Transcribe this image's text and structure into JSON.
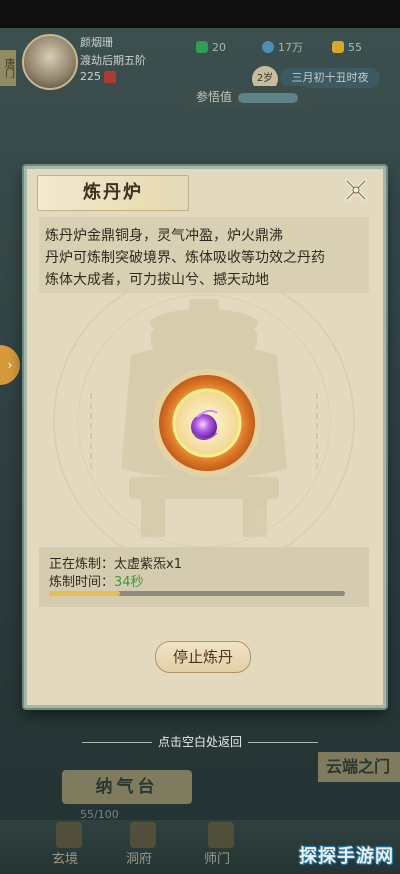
{
  "status_bar": {},
  "player": {
    "side_tag": "唐门",
    "name": "颜烟珊",
    "realm": "渡劫后期五阶",
    "power": "225"
  },
  "resources": [
    {
      "value": "20",
      "color": "#2f9e5a"
    },
    {
      "value": "17万",
      "color": "#4f8fb3"
    },
    {
      "value": "55",
      "color": "#d9a62e"
    }
  ],
  "world": {
    "age_badge": "2岁",
    "date": "三月初十丑时夜",
    "insight_label": "参悟值"
  },
  "modal": {
    "title": "炼丹炉",
    "description": [
      "炼丹炉金鼎铜身，灵气冲盈，炉火鼎沸",
      "丹炉可炼制突破境界、炼体吸收等功效之丹药",
      "炼体大成者，可力拔山兮、撼天动地"
    ],
    "status": {
      "refining_label": "正在炼制：",
      "refining_item": "太虚紫炁x1",
      "time_label": "炼制时间：",
      "time_value": "34秒",
      "progress": 0.24
    },
    "stop_button": "停止炼丹"
  },
  "hint": "点击空白处返回",
  "background_labels": {
    "naqi": "纳气台",
    "naqi_progress": "55/100",
    "yunduan": "云端之门"
  },
  "bottom_nav": [
    {
      "label": "玄境"
    },
    {
      "label": "洞府"
    },
    {
      "label": "师门"
    }
  ],
  "watermark": "探探手游网",
  "colors": {
    "modal_bg": "#e3d9be",
    "progress_fill": "#e3bf55",
    "time_green": "#3d9a3d",
    "orb_purple": "#a24bd6"
  }
}
